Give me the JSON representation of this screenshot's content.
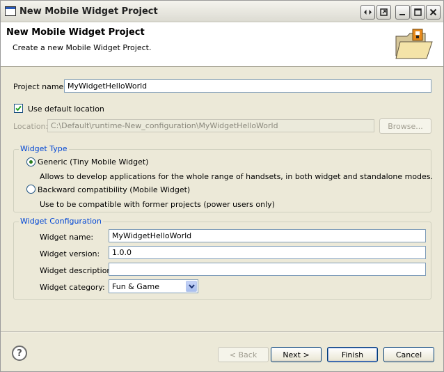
{
  "window": {
    "title": "New Mobile Widget Project"
  },
  "header": {
    "title": "New Mobile Widget Project",
    "description": "Create a new Mobile Widget Project."
  },
  "project": {
    "name_label": "Project name:",
    "name_value": "MyWidgetHelloWorld",
    "use_default_label": "Use default location",
    "use_default_checked": true,
    "location_label": "Location:",
    "location_value": "C:\\Default\\runtime-New_configuration\\MyWidgetHelloWorld",
    "browse_label": "Browse..."
  },
  "widget_type": {
    "legend": "Widget Type",
    "options": [
      {
        "label": "Generic (Tiny Mobile Widget)",
        "description": "Allows to develop applications for the whole range of handsets, in both widget and standalone modes.",
        "selected": true
      },
      {
        "label": "Backward compatibility (Mobile Widget)",
        "description": "Use to be compatible with former projects (power users only)",
        "selected": false
      }
    ]
  },
  "widget_config": {
    "legend": "Widget Configuration",
    "name_label": "Widget name:",
    "name_value": "MyWidgetHelloWorld",
    "version_label": "Widget version:",
    "version_value": "1.0.0",
    "description_label": "Widget description:",
    "description_value": "",
    "category_label": "Widget category:",
    "category_value": "Fun & Game"
  },
  "footer": {
    "help_glyph": "?",
    "back_label": "< Back",
    "next_label": "Next >",
    "finish_label": "Finish",
    "cancel_label": "Cancel"
  },
  "colors": {
    "group_legend": "#0046d5",
    "button_border": "#003c74"
  },
  "icons": {
    "title": "window-icon",
    "header": "folder-icon",
    "help": "help-icon"
  }
}
